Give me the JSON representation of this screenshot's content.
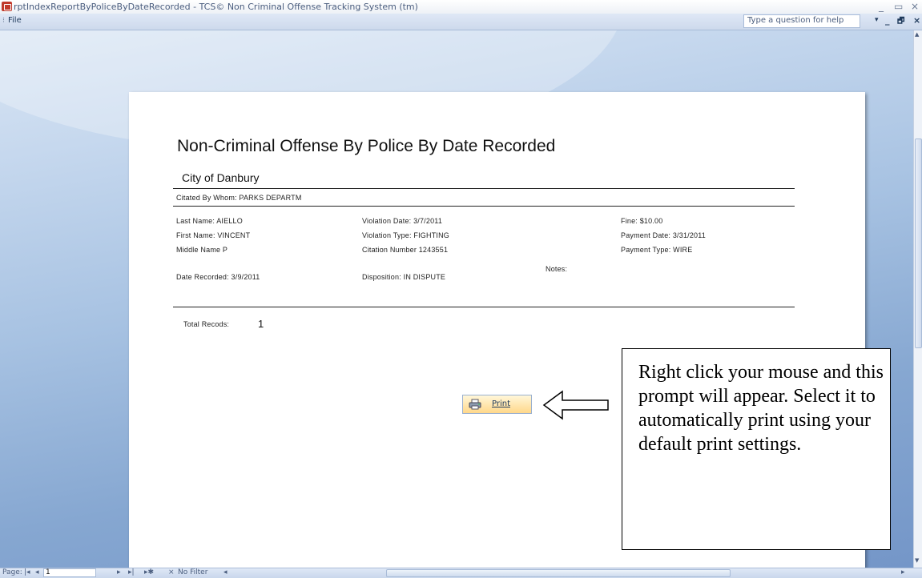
{
  "window": {
    "title": "rptIndexReportByPoliceByDateRecorded - TCS© Non Criminal Offense Tracking System (tm)",
    "minimize": "_",
    "restore": "▭",
    "close": "×"
  },
  "menubar": {
    "grip": "⁝",
    "file_label": "File",
    "help_placeholder": "Type a question for help",
    "help_dropdown": "▾",
    "doc_minimize": "_",
    "doc_restore": "🗗",
    "doc_close": "×"
  },
  "report": {
    "title": "Non-Criminal Offense By Police By Date Recorded",
    "subtitle": "City of Danbury",
    "cited_by": "Citated By Whom:   PARKS DEPARTM",
    "fields": {
      "last_name": "Last Name:   AIELLO",
      "first_name": "First Name:   VINCENT",
      "middle_name": "Middle Name   P",
      "date_recorded": "Date Recorded:   3/9/2011",
      "violation_date": "Violation Date:   3/7/2011",
      "violation_type": "Violation Type:   FIGHTING",
      "citation_number": "Citation Number   1243551",
      "disposition": "Disposition:      IN DISPUTE",
      "notes": "Notes:",
      "fine": "Fine:    $10.00",
      "payment_date": "Payment Date:   3/31/2011",
      "payment_type": "Payment Type:    WIRE"
    },
    "total_label": "Total Recods:",
    "total_value": "1"
  },
  "context_menu": {
    "print_label": "Print"
  },
  "callout": {
    "text": "Right click your mouse and this prompt will appear. Select it to automatically print using your default print settings."
  },
  "statusbar": {
    "page_label": "Page:",
    "first": "|◂",
    "prev": "◂",
    "page_value": "1",
    "next": "▸",
    "last": "▸|",
    "new": "▸✱",
    "filter_icon": "⨯",
    "filter_label": "No Filter",
    "scroll_left": "◂",
    "scroll_right": "▸"
  },
  "colors": {
    "workspace_top": "#dae6f4",
    "workspace_bottom": "#7496c8",
    "print_button": "#ffd88a",
    "app_icon": "#c0392b"
  }
}
